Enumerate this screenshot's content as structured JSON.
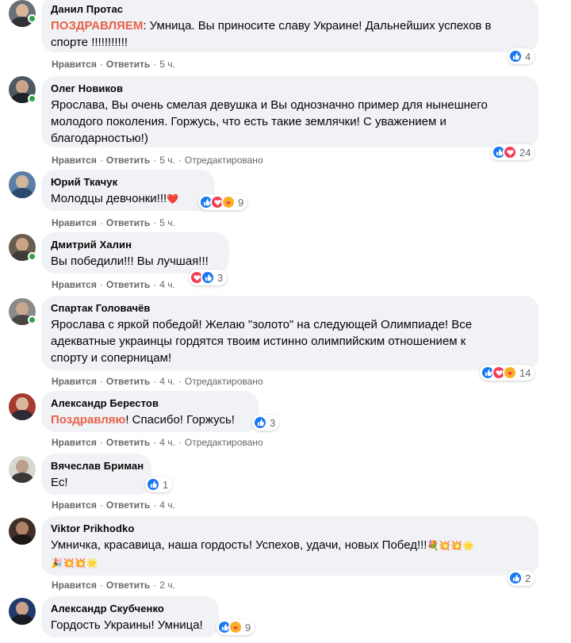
{
  "comments": [
    {
      "author": "Данил Протас",
      "highlight": "ПОЗДРАВЛЯЕМ",
      "text": ": Умница. Вы приносите славу Украине! Дальнейших успехов в\nспорте !!!!!!!!!!!",
      "like": "Нравится",
      "reply": "Ответить",
      "time": "5 ч.",
      "edited": "",
      "reactions": [
        "like"
      ],
      "count": "4"
    },
    {
      "author": "Олег Новиков",
      "highlight": "",
      "text": "Ярослава, Вы очень смелая девушка и Вы однозначно пример для нынешнего\nмолодого поколения. Горжусь, что есть такие землячки! С уважением и\nблагодарностью!)",
      "like": "Нравится",
      "reply": "Ответить",
      "time": "5 ч.",
      "edited": "Отредактировано",
      "reactions": [
        "like",
        "love"
      ],
      "count": "24"
    },
    {
      "author": "Юрий Ткачук",
      "highlight": "",
      "text": "Молодцы девчонки!!!",
      "emoji": "❤️",
      "like": "Нравится",
      "reply": "Ответить",
      "time": "5 ч.",
      "edited": "",
      "reactions": [
        "like",
        "love",
        "care"
      ],
      "count": "9"
    },
    {
      "author": "Дмитрий Халин",
      "highlight": "",
      "text": "Вы победили!!! Вы лучшая!!!",
      "like": "Нравится",
      "reply": "Ответить",
      "time": "4 ч.",
      "edited": "",
      "reactions": [
        "love",
        "like"
      ],
      "count": "3"
    },
    {
      "author": "Спартак Головачёв",
      "highlight": "",
      "text": "Ярослава с яркой победой! Желаю \"золото\" на следующей Олимпиаде! Все\nадекватные украинцы гордятся твоим истинно олимпийским отношением к\nспорту и соперницам!",
      "like": "Нравится",
      "reply": "Ответить",
      "time": "4 ч.",
      "edited": "Отредактировано",
      "reactions": [
        "like",
        "love",
        "care"
      ],
      "count": "14"
    },
    {
      "author": "Александр Берестов",
      "highlight": "Поздравляю",
      "text": "! Спасибо! Горжусь!",
      "like": "Нравится",
      "reply": "Ответить",
      "time": "4 ч.",
      "edited": "Отредактировано",
      "reactions": [
        "like"
      ],
      "count": "3"
    },
    {
      "author": "Вячеслав Бриман",
      "highlight": "",
      "text": "Ес!",
      "like": "Нравится",
      "reply": "Ответить",
      "time": "4 ч.",
      "edited": "",
      "reactions": [
        "like"
      ],
      "count": "1"
    },
    {
      "author": "Viktor Prikhodko",
      "highlight": "",
      "text": "Умничка, красавица, наша гордость! Успехов, удачи, новых Побед!!!",
      "emoji": "💐💥💥🌟",
      "emoji_line2": "🎉💥💥🌟",
      "like": "Нравится",
      "reply": "Ответить",
      "time": "2 ч.",
      "edited": "",
      "reactions": [
        "like"
      ],
      "count": "2"
    },
    {
      "author": "Александр Скубченко",
      "highlight": "",
      "text": "Гордость Украины! Умница!",
      "like": "",
      "reply": "",
      "time": "",
      "edited": "",
      "reactions": [
        "like",
        "care"
      ],
      "count": "9"
    }
  ],
  "colors": {
    "like": "#1877f2",
    "love": "#f33e58",
    "care": "#f7b125",
    "online": "#31a24c",
    "bubble": "#f0f2f5",
    "highlight": "#e8614a"
  }
}
